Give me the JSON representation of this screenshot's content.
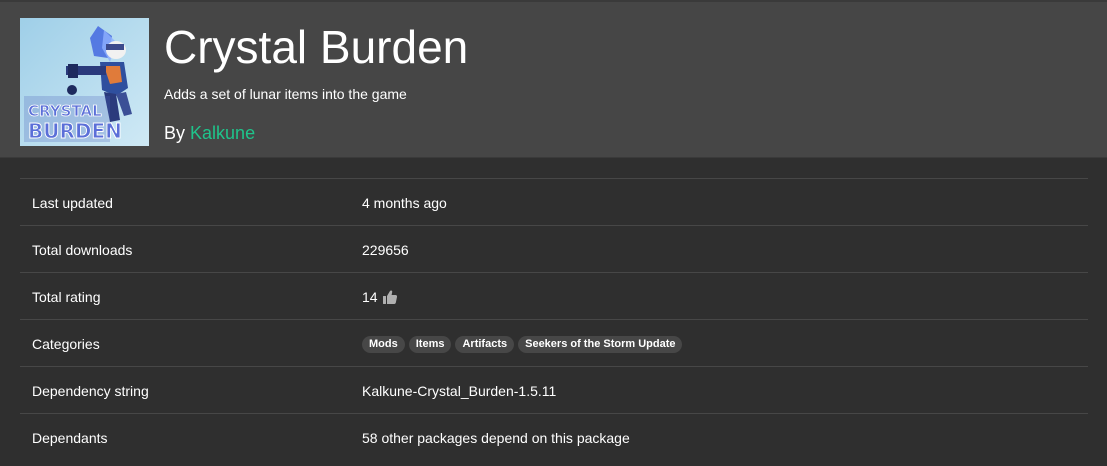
{
  "package": {
    "title": "Crystal Burden",
    "description": "Adds a set of lunar items into the game",
    "by_label": "By",
    "author": "Kalkune",
    "icon_text_line1": "CRYSTAL",
    "icon_text_line2": "BURDEN"
  },
  "details": {
    "last_updated": {
      "label": "Last updated",
      "value": "4 months ago"
    },
    "total_downloads": {
      "label": "Total downloads",
      "value": "229656"
    },
    "total_rating": {
      "label": "Total rating",
      "value": "14",
      "icon": "thumbs-up-icon"
    },
    "categories": {
      "label": "Categories",
      "tags": [
        "Mods",
        "Items",
        "Artifacts",
        "Seekers of the Storm Update"
      ]
    },
    "dependency_string": {
      "label": "Dependency string",
      "value": "Kalkune-Crystal_Burden-1.5.11"
    },
    "dependants": {
      "label": "Dependants",
      "value": "58 other packages depend on this package"
    }
  },
  "colors": {
    "accent_green": "#1fc48b",
    "header_bg": "#464646",
    "page_bg": "#2f2f2f",
    "tag_bg": "#474747"
  }
}
